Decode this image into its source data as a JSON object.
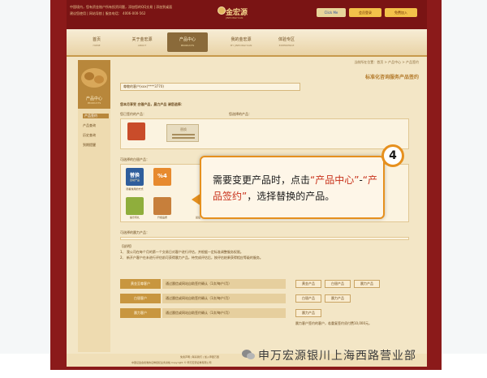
{
  "header": {
    "left_line1": "中国境内，您有资金账户所有投资问题，添加您的QQ交易 | 添加到桌面",
    "left_line2": "建议您使用 | 网站导航 | 服务电话： 4006-000-562",
    "logo_text": "金宏源",
    "logo_sub": "JINHONGYUAN",
    "btn_clickme": "Click Me",
    "btn_login": "会员登录",
    "btn_join": "免费加入"
  },
  "nav": [
    {
      "label": "首页",
      "sub": "HOME"
    },
    {
      "label": "关于金宏源",
      "sub": "ABOUT"
    },
    {
      "label": "产品中心",
      "sub": "PRODUCTS"
    },
    {
      "label": "我的金宏源",
      "sub": "MY JINHONGYUAN"
    },
    {
      "label": "体验专区",
      "sub": "EXPERIENCE"
    }
  ],
  "sidebar": {
    "title": "产品中心",
    "sub": "PRODUCTS",
    "items": [
      "产品签约",
      "产品查询",
      "历史查询",
      "到期提醒"
    ]
  },
  "main": {
    "breadcrumb": "当前所在位置：首页 > 产品中心 > 产品签约",
    "title": "标准化咨询服务产品签约",
    "greeting": "尊敬的客户(xxx)****3770)",
    "intro": "您本月享受 白银产品，晨力产品 请您选择：",
    "signed_label": "您已签约的产品：",
    "choose_label": "您选择的产品：",
    "switch_label": "替换",
    "available_label": "可选择的白银产品：",
    "tile_replace": "替换",
    "tile_replace_sub": "自动产品",
    "tile_replace_caption": "随着信用的方式",
    "tile_a_caption": "提示有礼",
    "tile_b_caption": "升级品质",
    "tile_c_caption": "晨后",
    "tile_d_caption": "金字塔",
    "power_label": "可选择的晨力产品：",
    "notes_title": "【说明】",
    "note1": "1、 我公司在每个月的第一个交易日对客户进行评估，并根据一定标准调整服务权限。",
    "note2": "2、 新开户客户在未进行评估前可获得晨力产品，待完成评估后，按评估结果获得相应等级的服务。",
    "rows": [
      {
        "label": "黄金至尊客户",
        "desc": "通过晨信或网站自助签约确认（1次/每户/月）",
        "btns": [
          "黄金产品",
          "白银产品",
          "晨力产品"
        ]
      },
      {
        "label": "白银客户",
        "desc": "通过晨信或网站自助签约确认（1次/每户/月）",
        "btns": [
          "白银产品",
          "晨力产品"
        ]
      },
      {
        "label": "晨力客户",
        "desc": "通过晨信或网站自助签约确认（1次/每户/月）",
        "btns": [
          "晨力产品"
        ]
      }
    ],
    "row_note": "晨力客户签约的客户，若重复签约须付费10,000元。"
  },
  "footer": {
    "links": "免责声明 | 联系我们 | 加入申银万国",
    "copyright": "中国证监会批准的证券经纪业务资格 Copyright © 申万宏源证券有限公司"
  },
  "callout": {
    "step": "4",
    "text_part1": "需要变更产品时，点击",
    "hl1": "“产品中心”",
    "text_part2": "-",
    "hl2": "“产品签约”",
    "text_part3": "，选择替换的产品。"
  },
  "watermark": "申万宏源银川上海西路营业部"
}
